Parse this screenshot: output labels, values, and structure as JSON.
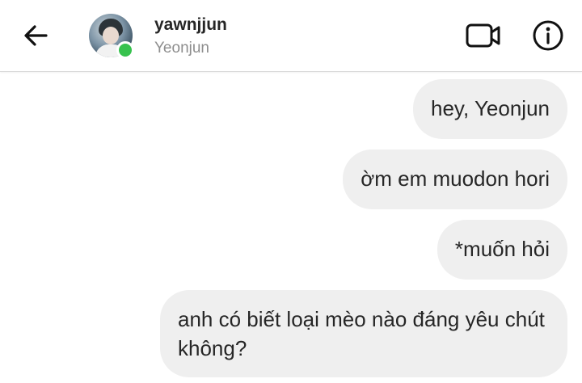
{
  "header": {
    "username": "yawnjjun",
    "display_name": "Yeonjun",
    "back_icon": "arrow-left-icon",
    "video_icon": "video-camera-icon",
    "info_icon": "info-icon",
    "online_color": "#37c24e"
  },
  "messages": [
    {
      "text": "hey, Yeonjun"
    },
    {
      "text": "ờm em muodon hori"
    },
    {
      "text": "*muốn hỏi"
    },
    {
      "text": "anh có biết loại mèo nào đáng yêu chút không?"
    }
  ],
  "colors": {
    "bubble_bg": "#efefef",
    "text": "#262626",
    "muted": "#8e8e8e"
  }
}
